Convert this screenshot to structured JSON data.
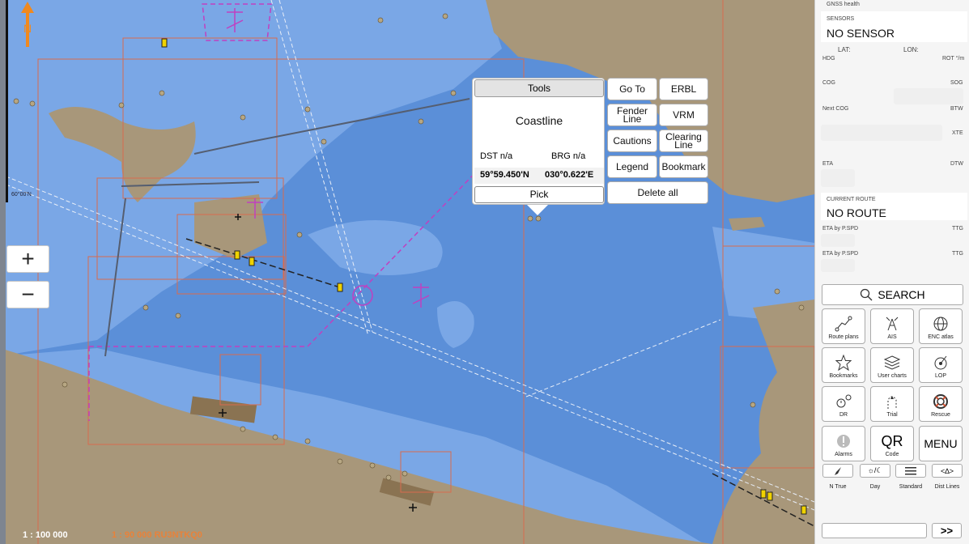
{
  "map": {
    "lat_tick": "60°00'N",
    "scale": "1 : 100 000",
    "cell_info": "1 : 90 000  RU3NTKQ0",
    "zoom_in": "+",
    "zoom_out": "−",
    "north_letter": "N"
  },
  "popup": {
    "tools_label": "Tools",
    "object_name": "Coastline",
    "dst_label": "DST  n/a",
    "brg_label": "BRG  n/a",
    "lat": "59°59.450'N",
    "lon": "030°0.622'E",
    "pick_label": "Pick"
  },
  "tools": {
    "goto": "Go To",
    "erbl": "ERBL",
    "fender_line": "Fender Line",
    "vrm": "VRM",
    "cautions": "Cautions",
    "clearing_line": "Clearing Line",
    "legend": "Legend",
    "bookmark": "Bookmark",
    "delete_all": "Delete all"
  },
  "sidebar": {
    "gnss_health": "GNSS health",
    "sensors_label": "SENSORS",
    "sensor_value": "NO SENSOR",
    "lat_label": "LAT:",
    "lon_label": "LON:",
    "hdg": "HDG",
    "rot": "ROT °/m",
    "cog": "COG",
    "sog": "SOG",
    "next_cog": "Next COG",
    "btw": "BTW",
    "xte": "XTE",
    "eta": "ETA",
    "dtw": "DTW",
    "current_route_label": "CURRENT ROUTE",
    "route_value": "NO ROUTE",
    "eta_pspd_1": "ETA by P.SPD",
    "ttg_1": "TTG",
    "eta_pspd_2": "ETA by P.SPD",
    "ttg_2": "TTG",
    "search": "SEARCH",
    "buttons": {
      "route_plans": "Route plans",
      "ais": "AIS",
      "enc_atlas": "ENC atlas",
      "bookmarks": "Bookmarks",
      "user_charts": "User charts",
      "lop": "LOP",
      "dr": "DR",
      "trial": "Trial",
      "rescue": "Rescue",
      "alarms": "Alarms",
      "code": "Code",
      "qr": "QR",
      "menu": "MENU"
    },
    "n_true": "N True",
    "day": "Day",
    "standard": "Standard",
    "dist_lines": "Dist Lines",
    "day_icon": "☼/☾",
    "dist_icon": "<∆>",
    "next": ">>"
  }
}
